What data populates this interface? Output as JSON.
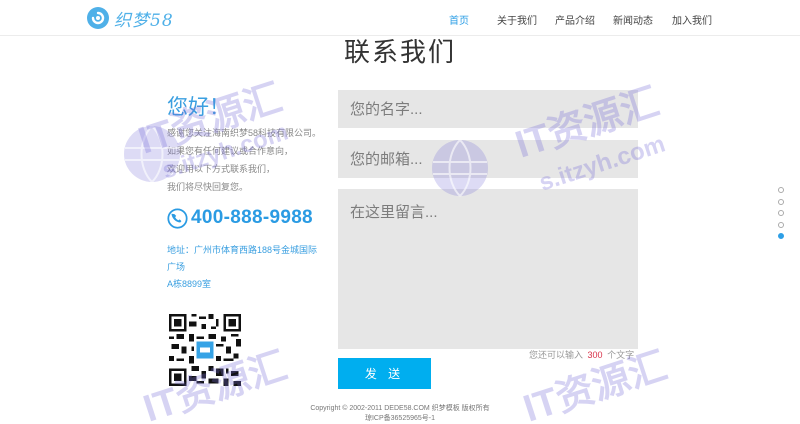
{
  "header": {
    "logo_text": "织梦58",
    "nav": [
      {
        "label": "首页",
        "active": true
      },
      {
        "label": "关于我们",
        "active": false
      },
      {
        "label": "产品介绍",
        "active": false
      },
      {
        "label": "新闻动态",
        "active": false
      },
      {
        "label": "加入我们",
        "active": false
      }
    ]
  },
  "section": {
    "title": "联系我们"
  },
  "contact": {
    "greeting": "您好！",
    "intro": [
      "感谢您关注海南织梦58科技有限公司。",
      "如果您有任何建议或合作意向，",
      "欢迎用以下方式联系我们，",
      "我们将尽快回复您。"
    ],
    "phone": "400-888-9988",
    "address": [
      "地址：广州市体育西路188号金城国际",
      "广场",
      "A栋8899室"
    ]
  },
  "form": {
    "name_placeholder": "您的名字...",
    "email_placeholder": "您的邮箱...",
    "message_placeholder": "在这里留言...",
    "counter_prefix": "您还可以输入",
    "counter_value": "300",
    "counter_suffix": "个文字",
    "submit_label": "发 送"
  },
  "pager": {
    "count": 5,
    "active_index": 4
  },
  "footer": {
    "copyright": "Copyright © 2002-2011 DEDE58.COM 织梦模板 版权所有",
    "icp": "琼ICP备36525965号-1"
  },
  "watermark": {
    "main": "IT资源汇",
    "sub": "s.itzyh.com"
  },
  "colors": {
    "accent": "#2e9fe6",
    "submit": "#00aeef",
    "field_bg": "#e6e6e6",
    "counter": "#d9324a"
  }
}
